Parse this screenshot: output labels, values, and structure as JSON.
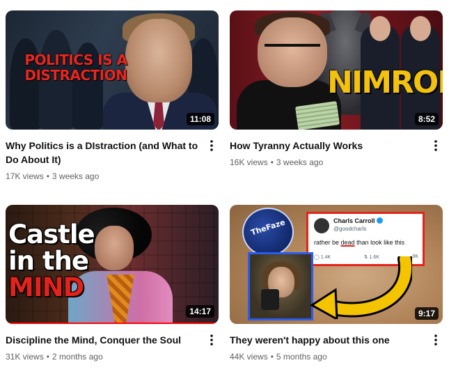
{
  "videos": [
    {
      "title": "Why Politics is a DIstraction (and What to Do About It)",
      "views": "17K views",
      "age": "3 weeks ago",
      "duration": "11:08",
      "thumb_text": "POLITICS IS A DISTRACTION"
    },
    {
      "title": "How Tyranny Actually Works",
      "views": "16K views",
      "age": "3 weeks ago",
      "duration": "8:52",
      "thumb_text": "NIMROD"
    },
    {
      "title": "Discipline the Mind, Conquer the Soul",
      "views": "31K views",
      "age": "2 months ago",
      "duration": "14:17",
      "thumb_text": [
        "Castle",
        "in the",
        "MIND"
      ],
      "watch_progress": 1.0
    },
    {
      "title": "They weren't happy about this one",
      "views": "44K views",
      "age": "5 months ago",
      "duration": "9:17",
      "thumb_text": {
        "logo": "TheFaze",
        "tweet_name": "Charls Carroll",
        "tweet_handle": "@goodcharls",
        "tweet_before": "rather be ",
        "tweet_dead": "dead",
        "tweet_after": " than look like this",
        "tweet_replies": "1.4K",
        "tweet_reposts": "1.6K",
        "tweet_likes": "9K"
      }
    }
  ],
  "colors": {
    "title": "#0f0f0f",
    "meta": "#606060",
    "progress": "#ff0000"
  },
  "icons": {
    "more": "more-vert-icon"
  }
}
